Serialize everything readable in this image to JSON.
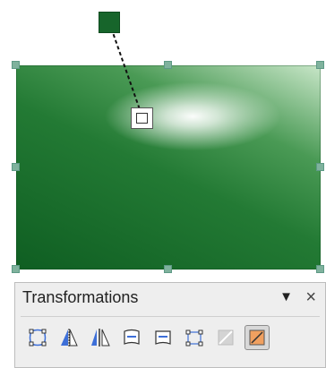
{
  "toolbar": {
    "title": "Transformations",
    "menu_icon": "triangle-down",
    "close_label": "×",
    "tools": [
      {
        "name": "points-tool",
        "icon": "points-icon",
        "active": false
      },
      {
        "name": "mirror-tool",
        "icon": "mirror-icon",
        "active": false
      },
      {
        "name": "in-3d-rotation-object-tool",
        "icon": "rotate-3d-icon",
        "active": false
      },
      {
        "name": "set-in-circle-perspective-tool",
        "icon": "circle-perspective-icon",
        "active": false
      },
      {
        "name": "set-in-circle-slant-tool",
        "icon": "circle-slant-icon",
        "active": false
      },
      {
        "name": "distort-tool",
        "icon": "distort-icon",
        "active": false
      },
      {
        "name": "transparency-tool",
        "icon": "transparency-icon",
        "active": false
      },
      {
        "name": "gradient-tool",
        "icon": "gradient-icon",
        "active": true
      }
    ]
  },
  "colors": {
    "gradient_start": "#17652b",
    "gradient_mid": "#237a34",
    "gradient_highlight": "#ffffff",
    "handle": "#7fb29d",
    "toolbar_bg": "#eeeeee",
    "accent_blue": "#3d6fd8",
    "accent_orange": "#f0a060"
  }
}
